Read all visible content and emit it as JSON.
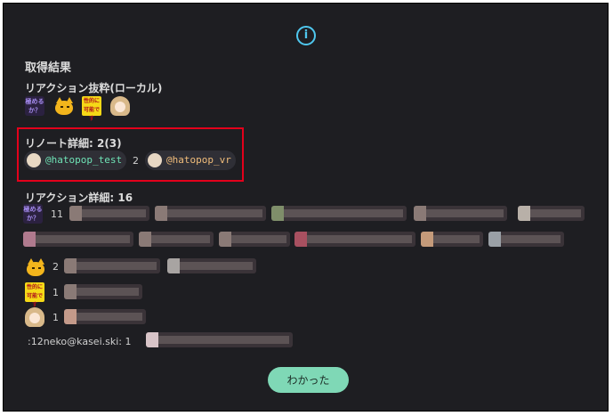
{
  "dialog": {
    "title": "取得結果",
    "reactions_excerpt_label": "リアクション抜粋(ローカル)",
    "renote_label": "リノート詳細: 2(3)",
    "renote_users": [
      {
        "handle": "@hatopop_test",
        "count": "2"
      },
      {
        "handle": "@hatopop_vr"
      }
    ],
    "reaction_detail_label": "リアクション詳細: 16",
    "reactions": [
      {
        "icon": "kiwameru-emoji-icon",
        "emoji_text": "極める\nか？",
        "count": "11"
      },
      {
        "icon": "cat-emoji-icon",
        "count": "2"
      },
      {
        "icon": "seitekini-emoji-icon",
        "emoji_text": "性的に\n可能です",
        "count": "1"
      },
      {
        "icon": "girl-emoji-icon",
        "count": "1"
      },
      {
        "shortcode": ":12neko@kasei.ski:",
        "count": "1"
      }
    ],
    "ok_button": "わかった"
  },
  "colors": {
    "background": "#1e1e22",
    "accent": "#7fd8b6",
    "info": "#4fc7ee",
    "highlight": "#e3001b"
  }
}
